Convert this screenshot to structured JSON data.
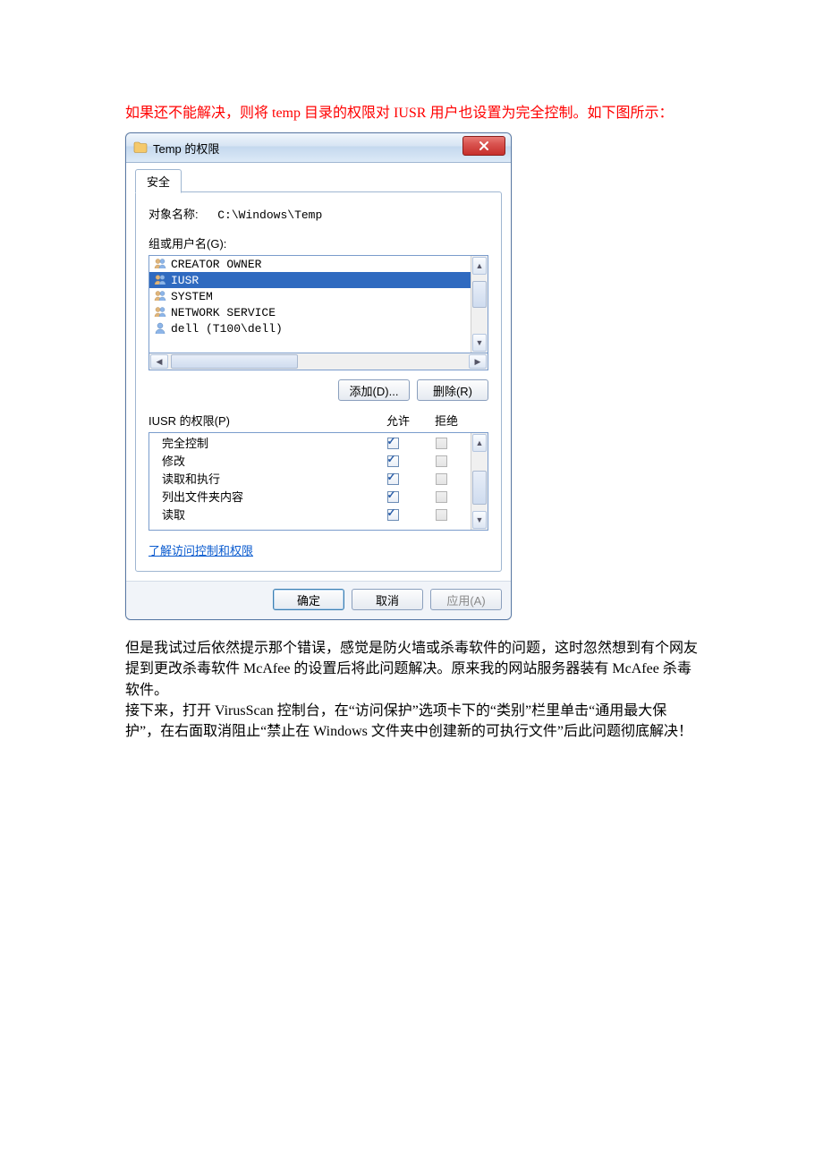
{
  "intro_red": "如果还不能解决，则将 temp 目录的权限对 IUSR 用户也设置为完全控制。如下图所示：",
  "body_text": "但是我试过后依然提示那个错误，感觉是防火墙或杀毒软件的问题，这时忽然想到有个网友提到更改杀毒软件 McAfee 的设置后将此问题解决。原来我的网站服务器装有 McAfee 杀毒软件。\n接下来，打开 VirusScan 控制台，在“访问保护”选项卡下的“类别”栏里单击“通用最大保护”，在右面取消阻止“禁止在 Windows 文件夹中创建新的可执行文件”后此问题彻底解决！",
  "dialog": {
    "title": "Temp 的权限",
    "tab": "安全",
    "object_label": "对象名称:",
    "object_path": "C:\\Windows\\Temp",
    "groups_label": "组或用户名(G):",
    "users": [
      {
        "name": "CREATOR OWNER",
        "icon": "group"
      },
      {
        "name": "IUSR",
        "icon": "group",
        "selected": true
      },
      {
        "name": "SYSTEM",
        "icon": "group"
      },
      {
        "name": "NETWORK SERVICE",
        "icon": "group"
      },
      {
        "name": "dell (T100\\dell)",
        "icon": "user"
      }
    ],
    "add_button": "添加(D)...",
    "remove_button": "删除(R)",
    "perm_label": "IUSR 的权限(P)",
    "allow_header": "允许",
    "deny_header": "拒绝",
    "permissions": [
      {
        "name": "完全控制",
        "allow": true,
        "deny": false
      },
      {
        "name": "修改",
        "allow": true,
        "deny": false
      },
      {
        "name": "读取和执行",
        "allow": true,
        "deny": false
      },
      {
        "name": "列出文件夹内容",
        "allow": true,
        "deny": false
      },
      {
        "name": "读取",
        "allow": true,
        "deny": false
      }
    ],
    "learn_link": "了解访问控制和权限",
    "ok_button": "确定",
    "cancel_button": "取消",
    "apply_button": "应用(A)"
  }
}
